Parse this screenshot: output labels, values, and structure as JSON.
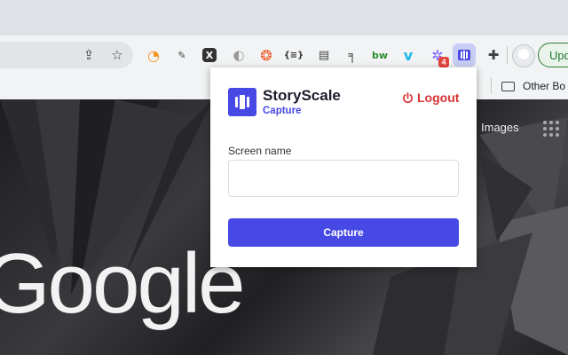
{
  "popup": {
    "brand_name": "StoryScale",
    "brand_sub": "Capture",
    "logout_label": "Logout",
    "field_label": "Screen name",
    "field_value": "",
    "capture_label": "Capture",
    "accent": "#4749e5",
    "logout_color": "#d83232"
  },
  "toolbar": {
    "update_label": "Upd",
    "extension_badge": "4",
    "extensions": [
      "rss-icon",
      "notepad-icon",
      "x-icon",
      "circle-icon",
      "hub-icon",
      "code-braces-icon",
      "document-icon",
      "slack-like-icon",
      "bw-icon",
      "vimeo-icon",
      "gear-badge-icon",
      "storyscale-icon",
      "puzzle-icon"
    ]
  },
  "bookmarks": {
    "folder_label": "Other Bo"
  },
  "page": {
    "logo_text": "Google",
    "images_link": "Images"
  }
}
